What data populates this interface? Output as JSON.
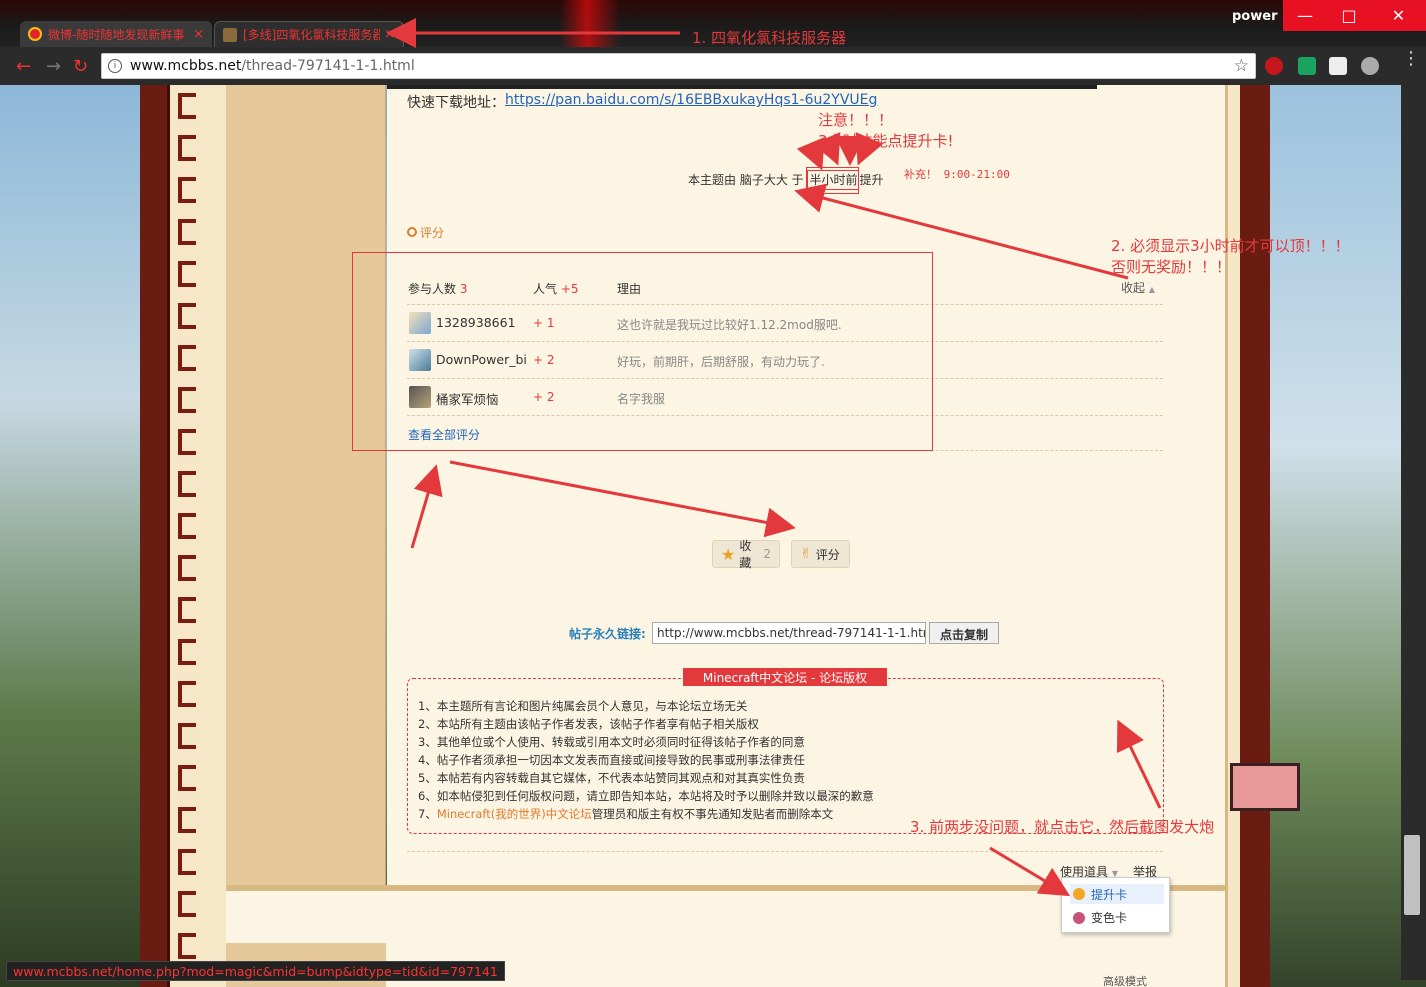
{
  "browser": {
    "user": "power",
    "tabs": [
      {
        "title": "微博-随时随地发现新鲜事",
        "close": "×"
      },
      {
        "title": "[多线]四氧化氯科技服务器",
        "close": "×"
      }
    ],
    "url_host": "www.mcbbs.net",
    "url_path": "/thread-797141-1-1.html",
    "status_url": "www.mcbbs.net/home.php?mod=magic&mid=bump&idtype=tid&id=797141"
  },
  "post": {
    "download_label": "快速下载地址：",
    "download_link": "https://pan.baidu.com/s/16EBBxukayHqs1-6u2YVUEg",
    "bump_prefix": "本主题由 脑子大大 于",
    "bump_time": "半小时前",
    "bump_suffix": "提升",
    "supplement": "补充！ 9:00-21:00"
  },
  "rating": {
    "section_title": "评分",
    "collapse": "收起",
    "head_participants": "参与人数",
    "participants": "3",
    "head_popularity": "人气",
    "popularity": "+5",
    "head_reason": "理由",
    "rows": [
      {
        "user": "1328938661",
        "score": "+ 1",
        "reason": "这也许就是我玩过比较好1.12.2mod服吧."
      },
      {
        "user": "DownPower_bi",
        "score": "+ 2",
        "reason": "好玩，前期肝，后期舒服，有动力玩了."
      },
      {
        "user": "桶家军烦恼",
        "score": "+ 2",
        "reason": "名字我服"
      }
    ],
    "view_all": "查看全部评分"
  },
  "actions": {
    "favorite_label": "收藏",
    "favorite_count": "2",
    "rate_label": "评分"
  },
  "permalink": {
    "label": "帖子永久链接:",
    "value": "http://www.mcbbs.net/thread-797141-1-1.html",
    "copy_button": "点击复制"
  },
  "copyright": {
    "title": "Minecraft中文论坛 - 论坛版权",
    "lines": [
      "1、本主题所有言论和图片纯属会员个人意见，与本论坛立场无关",
      "2、本站所有主题由该帖子作者发表，该帖子作者享有帖子相关版权",
      "3、其他单位或个人使用、转载或引用本文时必须同时征得该帖子作者的同意",
      "4、帖子作者须承担一切因本文发表而直接或间接导致的民事或刑事法律责任",
      "5、本帖若有内容转载自其它媒体，不代表本站赞同其观点和对其真实性负责",
      "6、如本帖侵犯到任何版权问题，请立即告知本站，本站将及时予以删除并致以最深的歉意"
    ],
    "line7_prefix": "7、",
    "line7_link": "Minecraft(我的世界)中文论坛",
    "line7_suffix": "管理员和版主有权不事先通知发贴者而删除本文"
  },
  "tools": {
    "use_item": "使用道具",
    "report": "举报",
    "menu": [
      "提升卡",
      "变色卡"
    ]
  },
  "annotations": {
    "a1": "1. 四氧化氯科技服务器",
    "note_line1": "注意！！！",
    "note_line2": "3小时才能点提升卡!",
    "a2_line1": "2. 必须显示3小时前才可以顶！！！",
    "a2_line2": "否则无奖励！！！",
    "a3": "3. 前两步没问题，就点击它，然后截图发大炮"
  }
}
